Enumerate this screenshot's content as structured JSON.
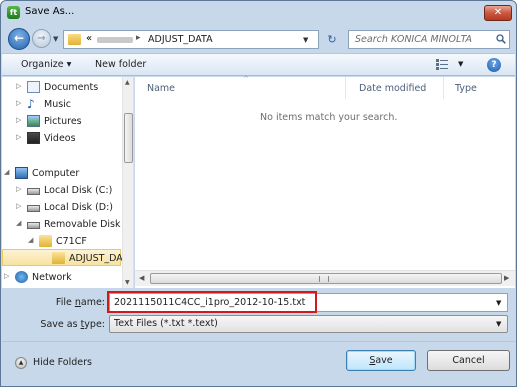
{
  "window": {
    "title": "Save As...",
    "close_symbol": "✕"
  },
  "address_bar": {
    "chevron": "«",
    "separator": "▸",
    "current_folder": "ADJUST_DATA"
  },
  "search": {
    "placeholder": "Search KONICA MINOLTA"
  },
  "toolbar": {
    "organize": "Organize ▾",
    "new_folder": "New folder"
  },
  "nav_tree": [
    {
      "label": "Documents",
      "icon": "documents-icon",
      "arrow": "▷",
      "indent": 1
    },
    {
      "label": "Music",
      "icon": "music-icon",
      "arrow": "▷",
      "indent": 1
    },
    {
      "label": "Pictures",
      "icon": "pictures-icon",
      "arrow": "▷",
      "indent": 1
    },
    {
      "label": "Videos",
      "icon": "videos-icon",
      "arrow": "▷",
      "indent": 1
    },
    {
      "label": "Computer",
      "icon": "computer-icon",
      "arrow": "◢",
      "indent": 0
    },
    {
      "label": "Local Disk (C:)",
      "icon": "local-disk-icon",
      "arrow": "▷",
      "indent": 1
    },
    {
      "label": "Local Disk (D:)",
      "icon": "local-disk-icon",
      "arrow": "▷",
      "indent": 1
    },
    {
      "label": "Removable Disk (",
      "icon": "removable-disk-icon",
      "arrow": "◢",
      "indent": 1
    },
    {
      "label": "C71CF",
      "icon": "folder-icon",
      "arrow": "◢",
      "indent": 2
    },
    {
      "label": "ADJUST_DAT",
      "icon": "folder-icon",
      "arrow": "",
      "indent": 3,
      "selected": true
    },
    {
      "label": "Network",
      "icon": "network-icon",
      "arrow": "▷",
      "indent": 0
    }
  ],
  "file_list": {
    "columns": [
      "Name",
      "Date modified",
      "Type"
    ],
    "empty_message": "No items match your search."
  },
  "file_name": {
    "label_prefix": "File ",
    "label_accel": "n",
    "label_suffix": "ame:",
    "value": "2021115011C4CC_i1pro_2012-10-15.txt"
  },
  "save_as_type": {
    "label_prefix": "Save as ",
    "label_accel": "t",
    "label_suffix": "ype:",
    "value": "Text Files (*.txt *.text)"
  },
  "footer": {
    "hide_folders": "Hide Folders",
    "save_accel": "S",
    "save_rest": "ave",
    "cancel": "Cancel"
  },
  "colors": {
    "highlight_border": "#d11b1b",
    "selected_bg": "#f7e2a1"
  }
}
